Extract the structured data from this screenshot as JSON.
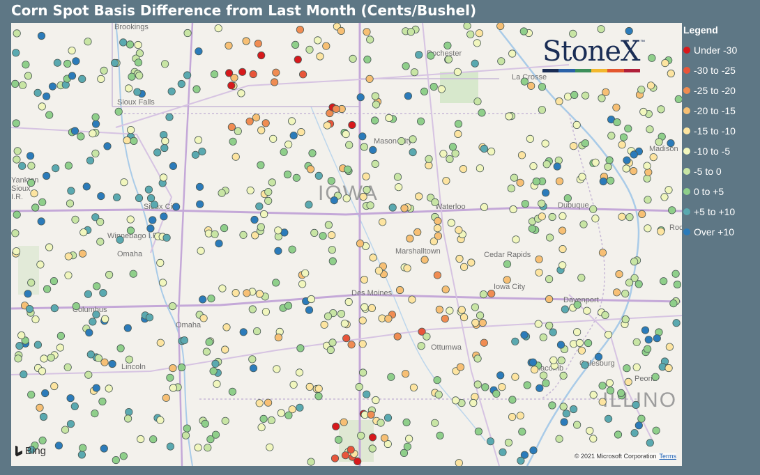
{
  "title": "Corn Spot Basis Difference from Last Month (Cents/Bushel)",
  "legend": {
    "title": "Legend",
    "items": [
      {
        "label": "Under -30",
        "color": "#d7191c"
      },
      {
        "label": "-30 to -25",
        "color": "#e8553a"
      },
      {
        "label": "-25 to -20",
        "color": "#f08c52"
      },
      {
        "label": "-20 to -15",
        "color": "#f7bf74"
      },
      {
        "label": "-15 to -10",
        "color": "#fde4a0"
      },
      {
        "label": "-10 to -5",
        "color": "#f1f6bd"
      },
      {
        "label": "-5 to 0",
        "color": "#c8e5a4"
      },
      {
        "label": "0 to +5",
        "color": "#8fcf8a"
      },
      {
        "label": "+5 to +10",
        "color": "#5aa9b0"
      },
      {
        "label": "Over +10",
        "color": "#2b7bba"
      }
    ]
  },
  "map": {
    "state_label": "IOWA",
    "state_label_2": "ILLINO",
    "cities": [
      "Brookings",
      "Rochester",
      "La Crosse",
      "Sioux Falls",
      "Mason City",
      "Madison",
      "Sioux City",
      "Waterloo",
      "Dubuque",
      "Winnebago I.R.",
      "Omaha",
      "Marshalltown",
      "Cedar Rapids",
      "Iowa City",
      "Des Moines",
      "Davenport",
      "Columbus",
      "Omaha",
      "Lincoln",
      "Ottumwa",
      "Galesburg",
      "Peoria",
      "Yankton Sioux I.R.",
      "Macomb",
      "Rockford"
    ],
    "attribution": "© 2021 Microsoft Corporation",
    "terms": "Terms",
    "provider": "Bing"
  },
  "logo": {
    "text": "StoneX",
    "tm": "™"
  }
}
